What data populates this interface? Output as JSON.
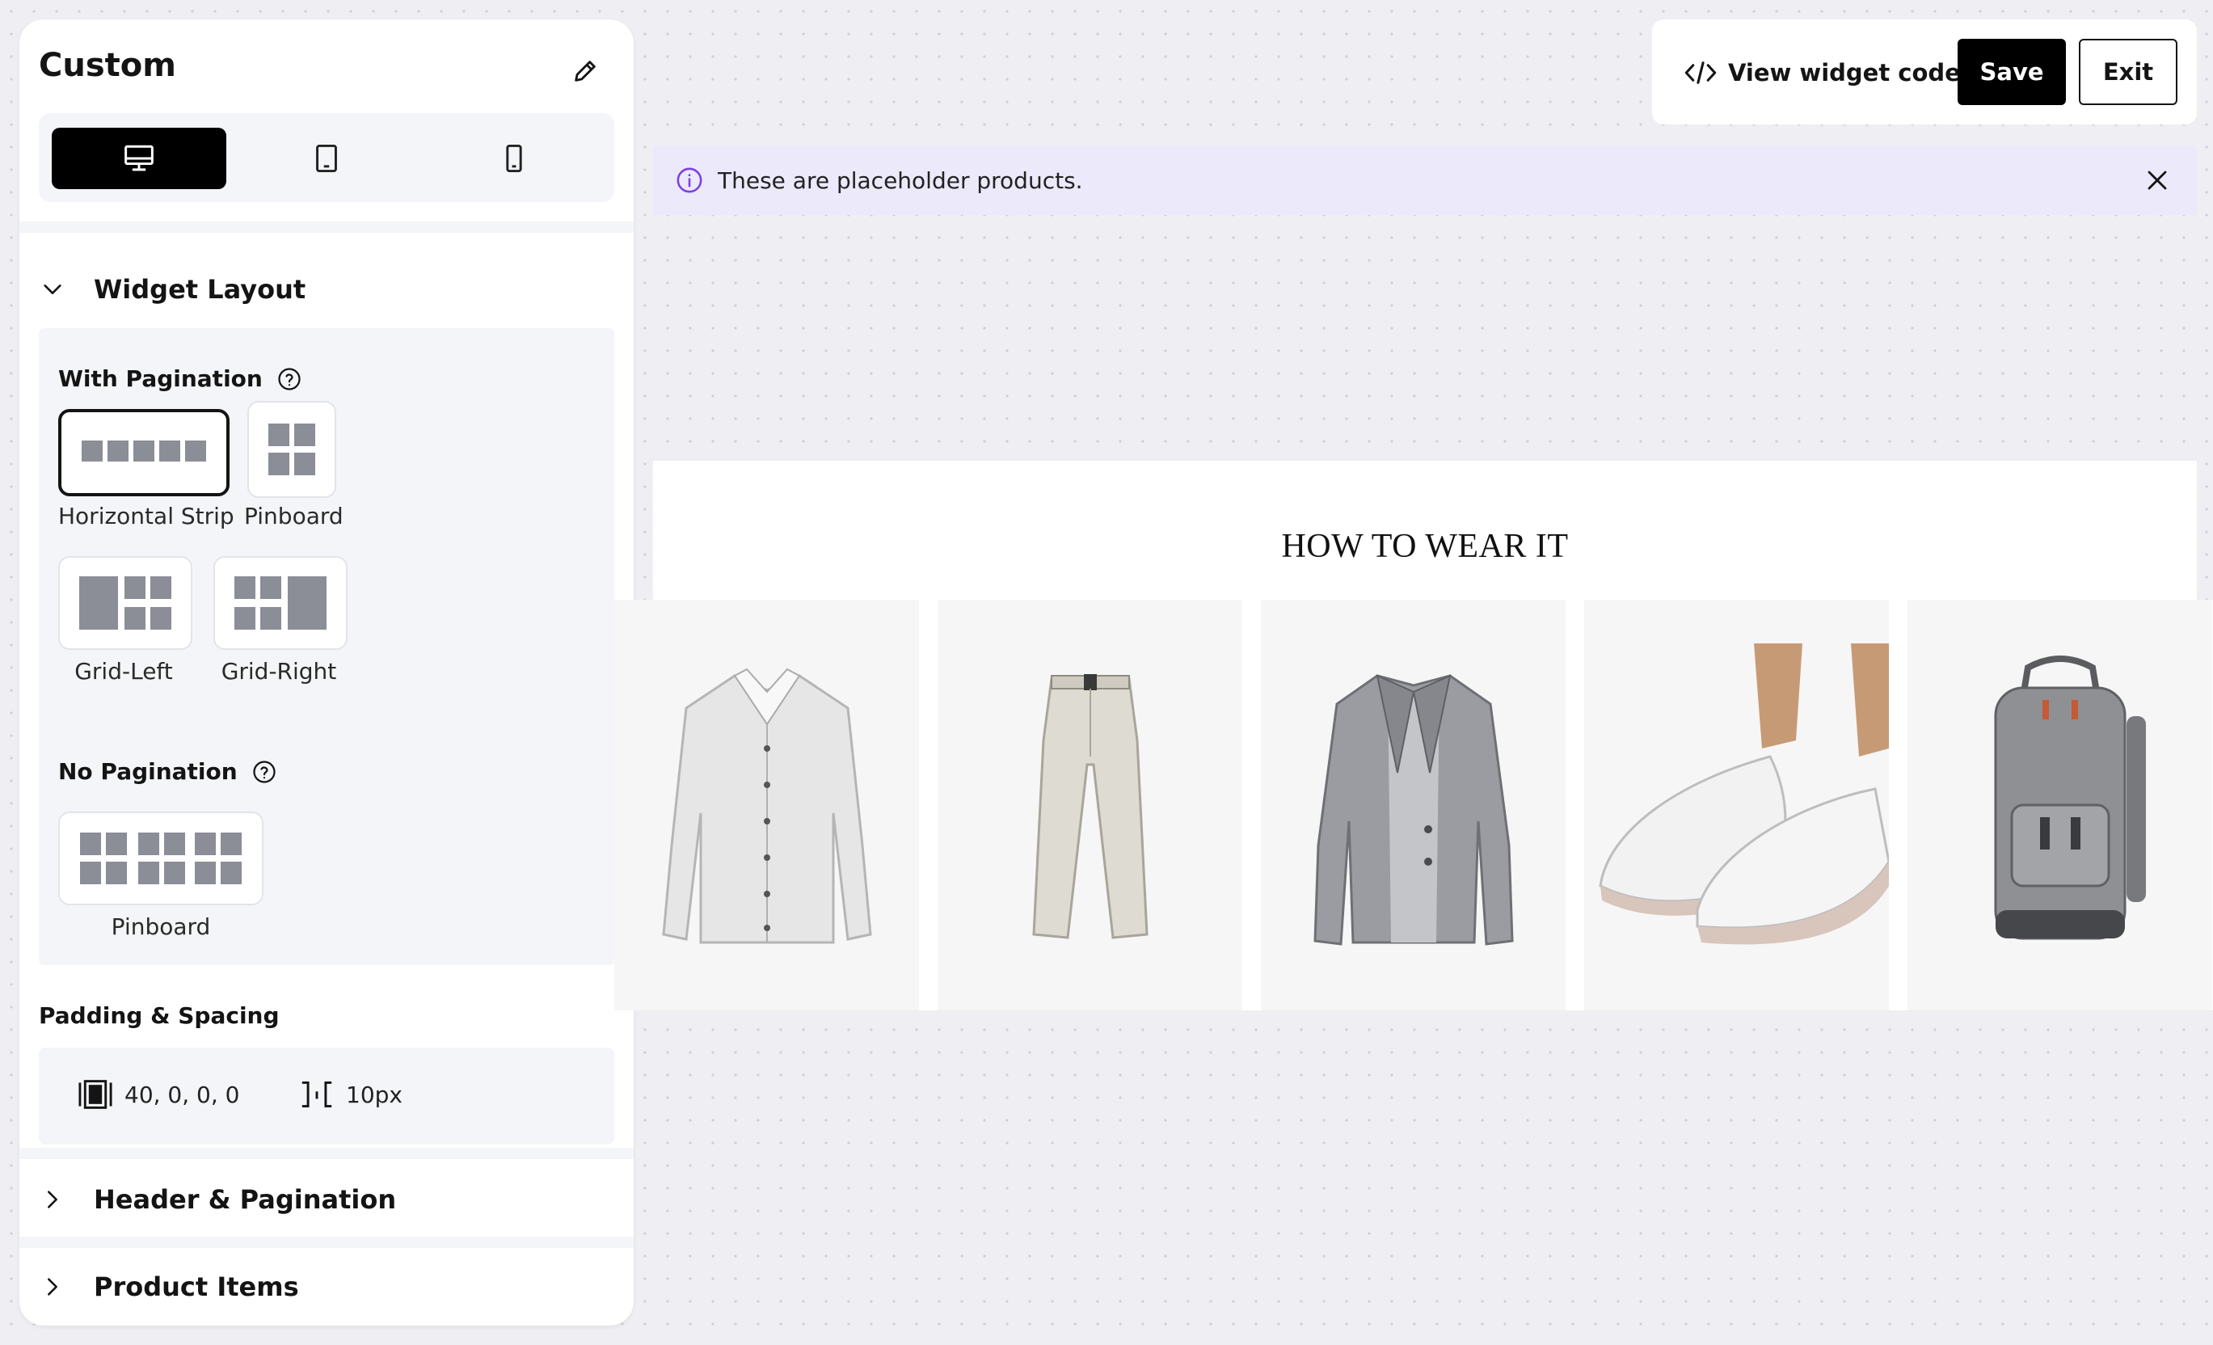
{
  "panel": {
    "title": "Custom",
    "devices": [
      "desktop-icon",
      "tablet-icon",
      "mobile-icon"
    ],
    "active_device": "desktop"
  },
  "widget_layout": {
    "title": "Widget Layout",
    "with_pagination": {
      "label": "With Pagination",
      "options": [
        "Horizontal Strip",
        "Pinboard",
        "Grid-Left",
        "Grid-Right"
      ],
      "selected": "Horizontal Strip"
    },
    "no_pagination": {
      "label": "No Pagination",
      "options": [
        "Pinboard"
      ]
    }
  },
  "padding": {
    "title": "Padding & Spacing",
    "padding_value": "40, 0, 0, 0",
    "spacing_value": "10px"
  },
  "sections": {
    "header_pagination": "Header & Pagination",
    "product_items": "Product Items"
  },
  "toolbar": {
    "code_label": "View widget code",
    "save_label": "Save",
    "exit_label": "Exit"
  },
  "notice": {
    "text": "These are placeholder products."
  },
  "preview": {
    "title": "HOW TO WEAR IT",
    "products": [
      "shirt",
      "trousers",
      "blazer",
      "sneakers",
      "backpack"
    ]
  },
  "colors": {
    "accent_info": "#7b3fe4",
    "primary": "#000000",
    "notice_bg": "#ebe9fa"
  }
}
